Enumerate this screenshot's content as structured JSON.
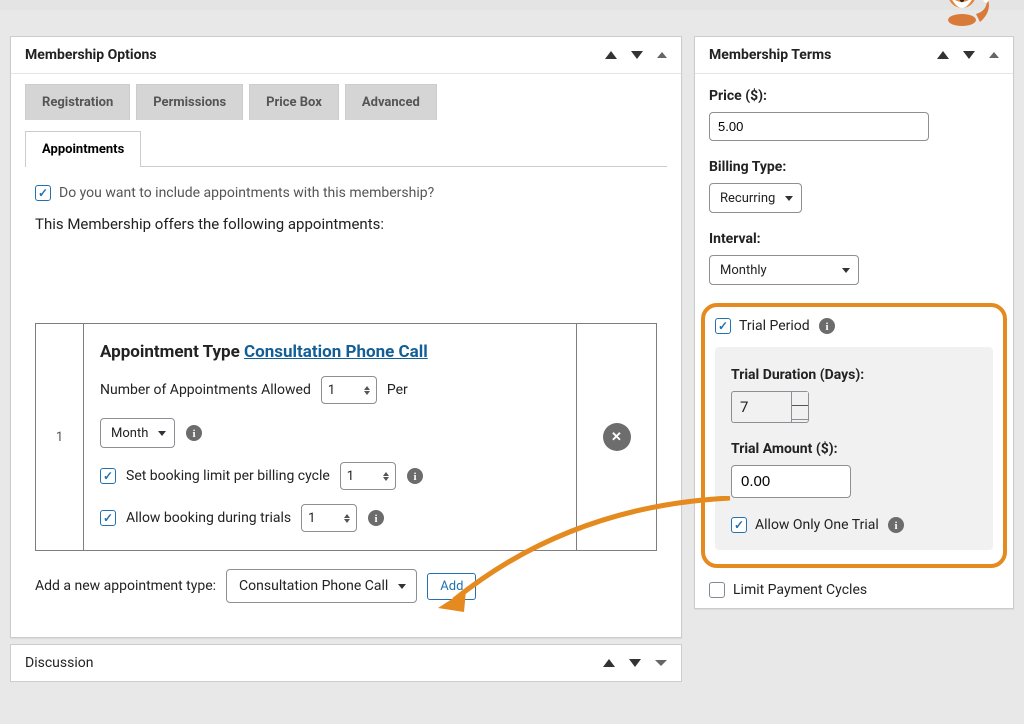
{
  "membership_options": {
    "title": "Membership Options",
    "tabs": {
      "registration": "Registration",
      "permissions": "Permissions",
      "pricebox": "Price Box",
      "advanced": "Advanced",
      "appointments": "Appointments"
    },
    "include_question": "Do you want to include appointments with this membership?",
    "offers_heading": "This Membership offers the following appointments:",
    "row_number": "1",
    "appointment_type_label": "Appointment Type",
    "appointment_type_link": "Consultation Phone Call",
    "num_appts_label": "Number of Appointments Allowed",
    "num_appts_value": "1",
    "per_label": "Per",
    "per_unit": "Month",
    "booking_limit_label": "Set booking limit per billing cycle",
    "booking_limit_value": "1",
    "allow_trials_label": "Allow booking during trials",
    "allow_trials_value": "1",
    "add_new_label": "Add a new appointment type:",
    "add_new_select": "Consultation Phone Call",
    "add_btn": "Add"
  },
  "discussion": {
    "title": "Discussion"
  },
  "membership_terms": {
    "title": "Membership Terms",
    "price_label": "Price ($):",
    "price_value": "5.00",
    "billing_type_label": "Billing Type:",
    "billing_type_value": "Recurring",
    "interval_label": "Interval:",
    "interval_value": "Monthly",
    "trial_period_label": "Trial Period",
    "trial_duration_label": "Trial Duration (Days):",
    "trial_duration_value": "7",
    "trial_amount_label": "Trial Amount ($):",
    "trial_amount_value": "0.00",
    "only_one_trial_label": "Allow Only One Trial",
    "limit_cycles_label": "Limit Payment Cycles"
  }
}
